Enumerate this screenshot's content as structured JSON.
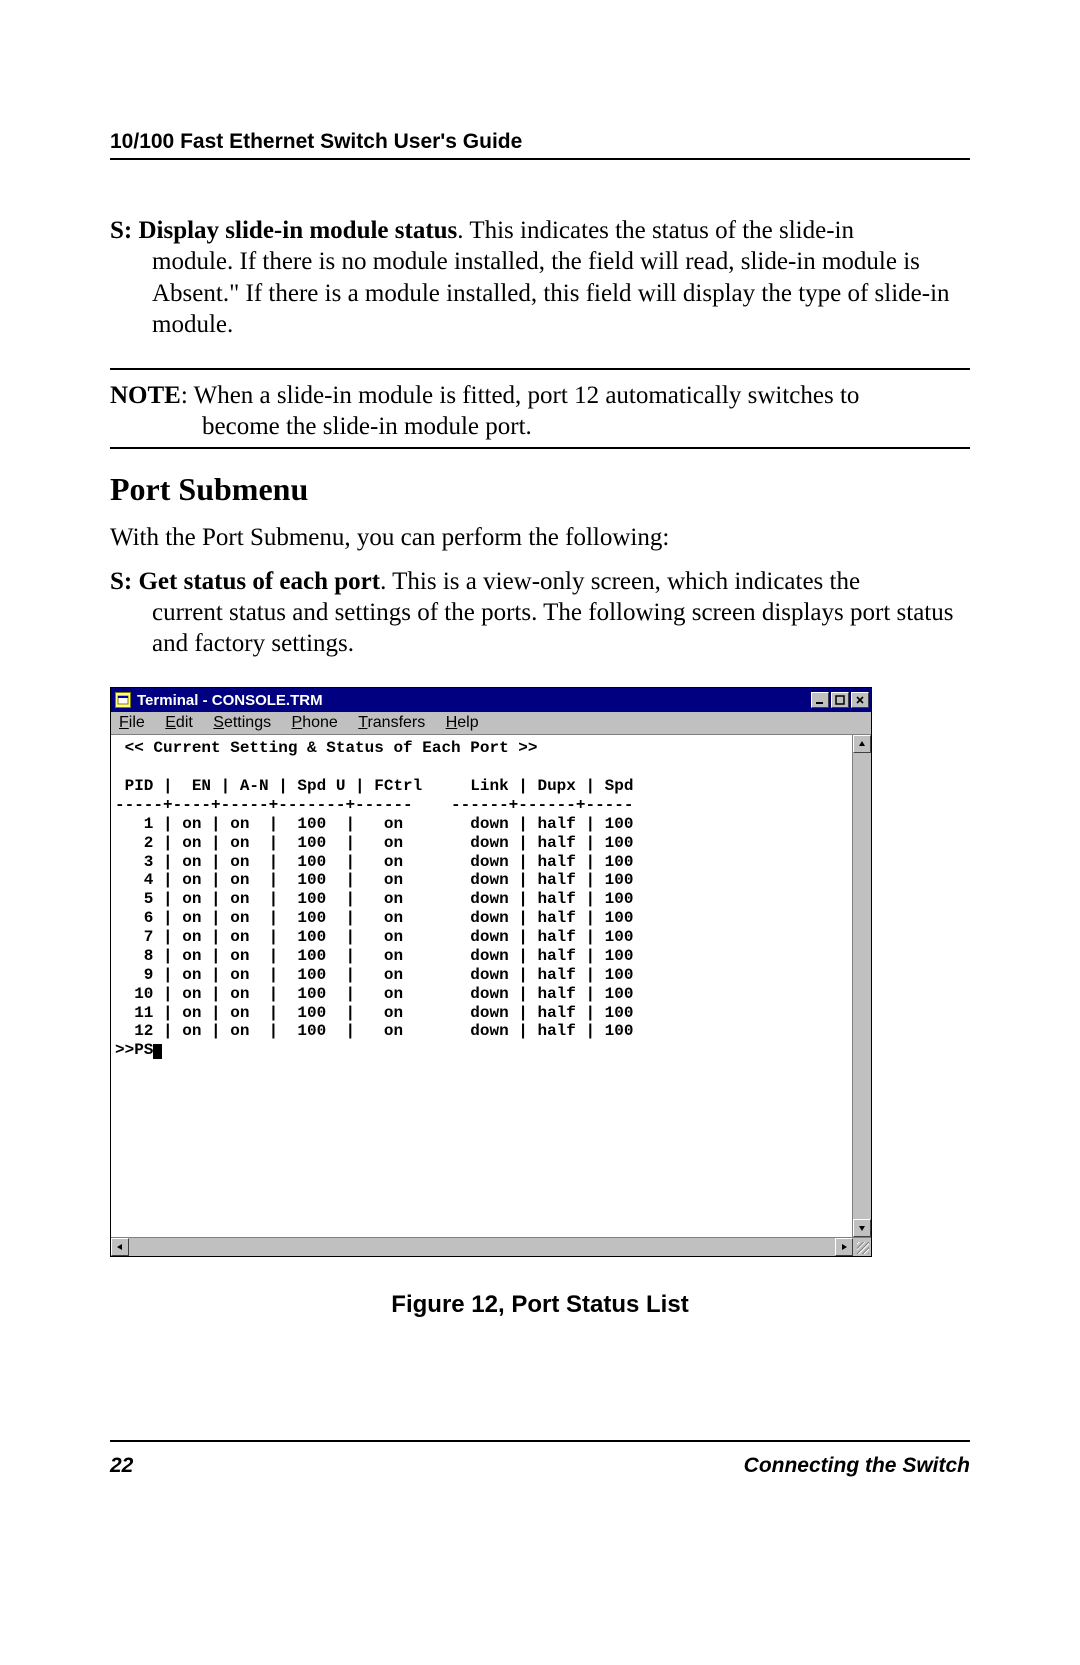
{
  "header": {
    "title": "10/100 Fast Ethernet Switch User's Guide"
  },
  "para1": {
    "label": "S: Display slide-in module status",
    "first_line_tail": ".  This indicates the status of the slide-in",
    "cont": "module.   If there is no module installed, the field will read, slide-in module is Absent.\"  If there is a module installed, this field will display the type of slide-in module."
  },
  "note": {
    "label": "NOTE",
    "first_line_tail": ": When a slide-in module is fitted, port 12 automatically switches to",
    "cont": "become the slide-in module port."
  },
  "section_heading": "Port Submenu",
  "para_intro": "With the Port Submenu, you can perform the following:",
  "para2": {
    "label": "S: Get status of each port",
    "first_line_tail": ".  This is a view-only screen, which indicates the",
    "cont": "current status and settings of the ports. The following screen displays port status and factory settings."
  },
  "terminal": {
    "title": "Terminal - CONSOLE.TRM",
    "menus": {
      "file": "File",
      "edit": "Edit",
      "settings": "Settings",
      "phone": "Phone",
      "transfers": "Transfers",
      "help": "Help"
    },
    "heading": " << Current Setting & Status of Each Port >>",
    "columns_line": " PID |  EN | A-N | Spd U | FCtrl     Link | Dupx | Spd",
    "separator_line": "-----+----+-----+-------+------    ------+------+-----",
    "rows": [
      {
        "pid": "1",
        "en": "on",
        "an": "on",
        "spdu": "100",
        "fctrl": "on",
        "link": "down",
        "dupx": "half",
        "spd": "100"
      },
      {
        "pid": "2",
        "en": "on",
        "an": "on",
        "spdu": "100",
        "fctrl": "on",
        "link": "down",
        "dupx": "half",
        "spd": "100"
      },
      {
        "pid": "3",
        "en": "on",
        "an": "on",
        "spdu": "100",
        "fctrl": "on",
        "link": "down",
        "dupx": "half",
        "spd": "100"
      },
      {
        "pid": "4",
        "en": "on",
        "an": "on",
        "spdu": "100",
        "fctrl": "on",
        "link": "down",
        "dupx": "half",
        "spd": "100"
      },
      {
        "pid": "5",
        "en": "on",
        "an": "on",
        "spdu": "100",
        "fctrl": "on",
        "link": "down",
        "dupx": "half",
        "spd": "100"
      },
      {
        "pid": "6",
        "en": "on",
        "an": "on",
        "spdu": "100",
        "fctrl": "on",
        "link": "down",
        "dupx": "half",
        "spd": "100"
      },
      {
        "pid": "7",
        "en": "on",
        "an": "on",
        "spdu": "100",
        "fctrl": "on",
        "link": "down",
        "dupx": "half",
        "spd": "100"
      },
      {
        "pid": "8",
        "en": "on",
        "an": "on",
        "spdu": "100",
        "fctrl": "on",
        "link": "down",
        "dupx": "half",
        "spd": "100"
      },
      {
        "pid": "9",
        "en": "on",
        "an": "on",
        "spdu": "100",
        "fctrl": "on",
        "link": "down",
        "dupx": "half",
        "spd": "100"
      },
      {
        "pid": "10",
        "en": "on",
        "an": "on",
        "spdu": "100",
        "fctrl": "on",
        "link": "down",
        "dupx": "half",
        "spd": "100"
      },
      {
        "pid": "11",
        "en": "on",
        "an": "on",
        "spdu": "100",
        "fctrl": "on",
        "link": "down",
        "dupx": "half",
        "spd": "100"
      },
      {
        "pid": "12",
        "en": "on",
        "an": "on",
        "spdu": "100",
        "fctrl": "on",
        "link": "down",
        "dupx": "half",
        "spd": "100"
      }
    ],
    "prompt": ">>PS"
  },
  "figure_caption": "Figure 12, Port Status List",
  "footer": {
    "page": "22",
    "section": "Connecting the Switch"
  }
}
